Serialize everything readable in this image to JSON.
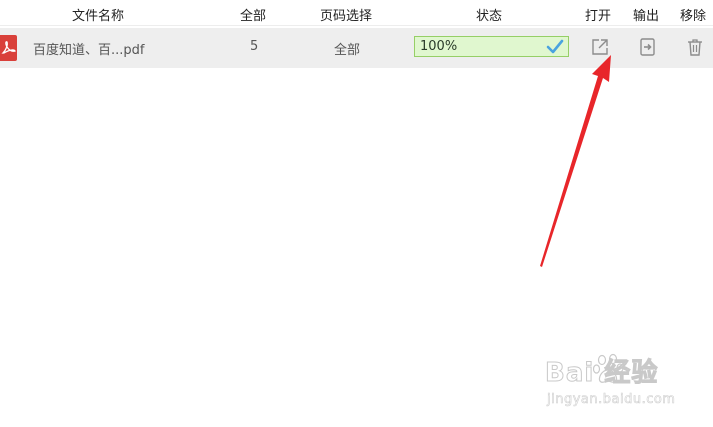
{
  "header": {
    "name": "文件名称",
    "total": "全部",
    "pages": "页码选择",
    "status": "状态",
    "open": "打开",
    "export": "输出",
    "remove": "移除"
  },
  "files": [
    {
      "icon": "pdf-file-icon",
      "name": "百度知道、百...pdf",
      "total": "5",
      "pages": "全部",
      "progress": 1.0,
      "progress_text": "100%",
      "status_icon": "check-icon"
    }
  ],
  "actions": {
    "open_icon": "open-external-icon",
    "export_icon": "export-icon",
    "remove_icon": "trash-icon"
  },
  "watermark": {
    "brand": "Bai  经验",
    "url": "jingyan.baidu.com"
  },
  "colors": {
    "pdf_red": "#d9403a",
    "progress_bg": "#e0f7cf",
    "progress_border": "#96cf66",
    "check_blue": "#4aa3df",
    "arrow_red": "#e8262a",
    "row_bg": "#eeeeee"
  }
}
